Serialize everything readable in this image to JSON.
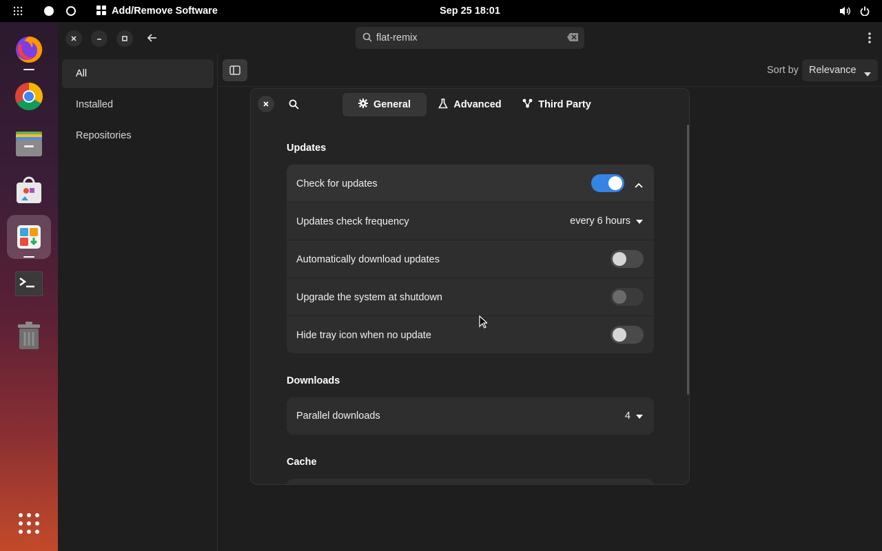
{
  "topbar": {
    "app_title": "Add/Remove Software",
    "clock": "Sep 25  18:01"
  },
  "dock": {
    "items": [
      "firefox",
      "chrome",
      "files",
      "app-store",
      "software-manager",
      "terminal",
      "trash",
      "show-apps"
    ]
  },
  "search": {
    "value": "flat-remix"
  },
  "sidebar": {
    "items": [
      {
        "label": "All"
      },
      {
        "label": "Installed"
      },
      {
        "label": "Repositories"
      }
    ]
  },
  "content": {
    "sort_by_label": "Sort by",
    "sort_by_value": "Relevance"
  },
  "dialog": {
    "tabs": [
      {
        "label": "General",
        "icon": "gear-icon"
      },
      {
        "label": "Advanced",
        "icon": "flask-icon"
      },
      {
        "label": "Third Party",
        "icon": "branch-icon"
      }
    ],
    "updates": {
      "title": "Updates",
      "check_for_updates": {
        "label": "Check for updates",
        "enabled": true
      },
      "frequency": {
        "label": "Updates check frequency",
        "value": "every 6 hours"
      },
      "auto_download": {
        "label": "Automatically download updates",
        "enabled": false
      },
      "upgrade_shutdown": {
        "label": "Upgrade the system at shutdown",
        "enabled": false
      },
      "hide_tray": {
        "label": "Hide tray icon when no update",
        "enabled": false
      }
    },
    "downloads": {
      "title": "Downloads",
      "parallel": {
        "label": "Parallel downloads",
        "value": "4"
      }
    },
    "cache": {
      "title": "Cache"
    }
  },
  "colors": {
    "accent": "#3584e4",
    "window_bg": "#1e1e1e",
    "dialog_bg": "#242424",
    "row_bg": "#2e2e2e"
  }
}
